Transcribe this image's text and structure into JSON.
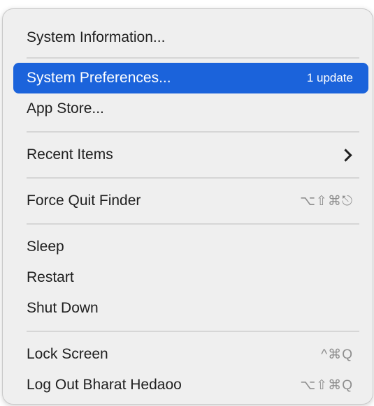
{
  "menu": {
    "system_information": "System Information...",
    "system_preferences": "System Preferences...",
    "system_preferences_badge": "1 update",
    "app_store": "App Store...",
    "recent_items": "Recent Items",
    "recent_items_arrow_icon": "chevron-right-icon",
    "force_quit": "Force Quit Finder",
    "force_quit_shortcut": "⌥⇧⌘⎋",
    "sleep": "Sleep",
    "restart": "Restart",
    "shut_down": "Shut Down",
    "lock_screen": "Lock Screen",
    "lock_screen_shortcut": "^⌘Q",
    "log_out": "Log Out Bharat Hedaoo",
    "log_out_shortcut": "⌥⇧⌘Q"
  },
  "colors": {
    "selection": "#1b63db",
    "menu_background": "#efefef"
  }
}
